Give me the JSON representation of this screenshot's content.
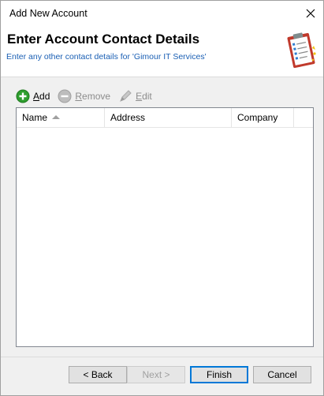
{
  "window": {
    "title": "Add New Account"
  },
  "header": {
    "heading": "Enter Account Contact Details",
    "subtitle": "Enter any other contact details for 'Gimour IT Services'"
  },
  "toolbar": {
    "add_label": "Add",
    "remove_label": "Remove",
    "edit_label": "Edit"
  },
  "table": {
    "columns": [
      "Name",
      "Address",
      "Company"
    ],
    "sort_column": "Name",
    "rows": []
  },
  "buttons": {
    "back": "< Back",
    "next": "Next >",
    "finish": "Finish",
    "cancel": "Cancel"
  },
  "colors": {
    "subtitle": "#1a5fb4",
    "add_icon": "#2e9e2e",
    "default_button_border": "#0078d7"
  }
}
